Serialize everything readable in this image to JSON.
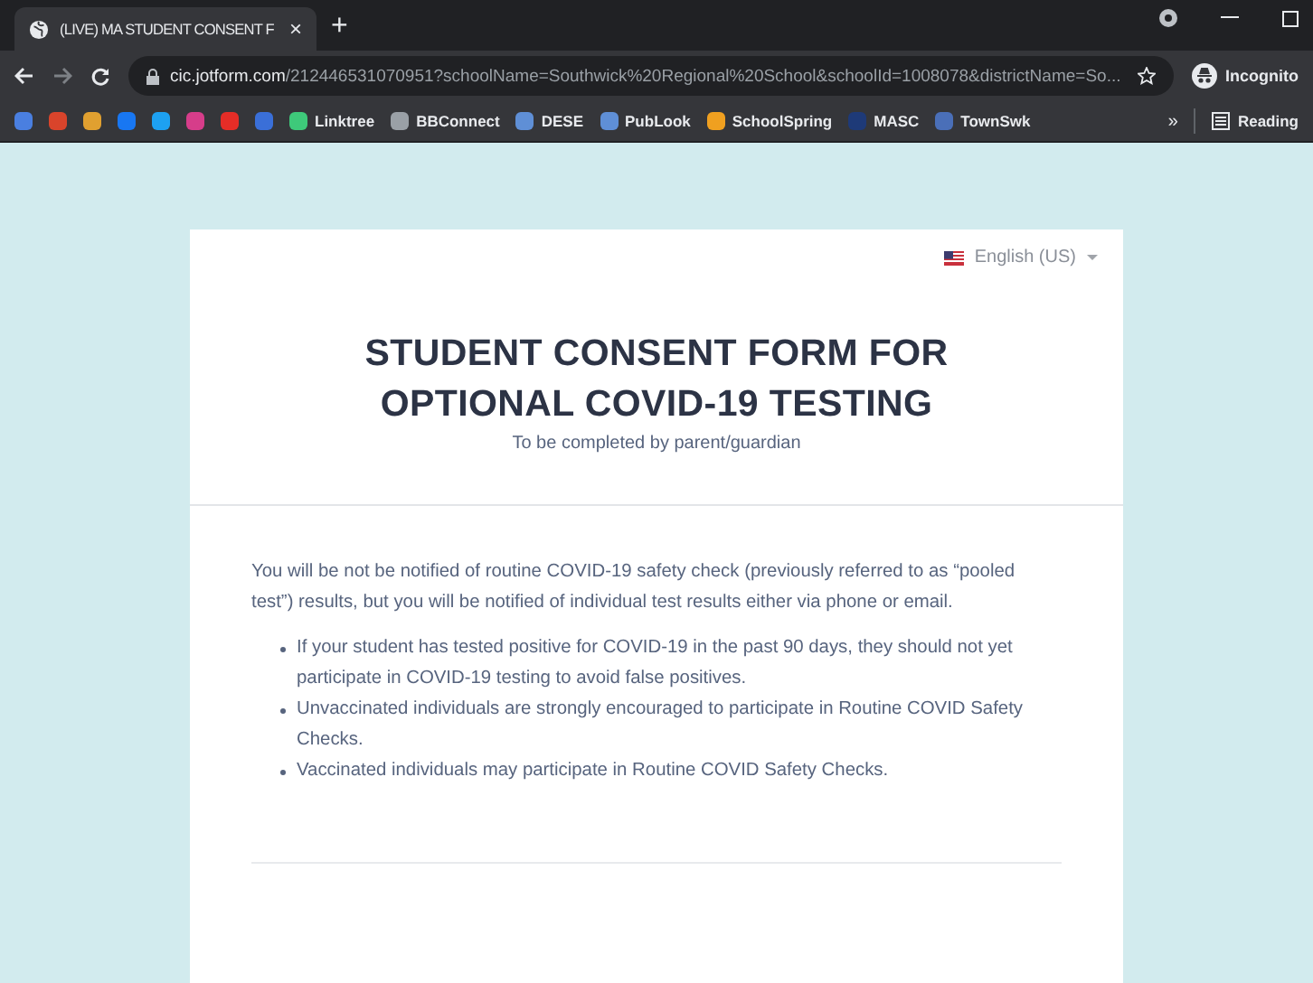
{
  "browser": {
    "tab": {
      "title": "(LIVE) MA STUDENT CONSENT F",
      "close": "×",
      "selected": true
    },
    "new_tab": "+",
    "address": {
      "domain": "cic.jotform.com",
      "path": "/212446531070951?schoolName=Southwick%20Regional%20School&schoolId=1008078&districtName=So..."
    },
    "profile": "Incognito",
    "bookmarks": [
      {
        "kind": "icon",
        "color": "#4a7fe0"
      },
      {
        "kind": "icon",
        "color": "#d9442b"
      },
      {
        "kind": "icon",
        "color": "#e0a030"
      },
      {
        "kind": "icon",
        "color": "#1877f2"
      },
      {
        "kind": "icon",
        "color": "#1da1f2"
      },
      {
        "kind": "icon",
        "color": "#d63d8a"
      },
      {
        "kind": "icon",
        "color": "#e52d27"
      },
      {
        "kind": "icon",
        "color": "#3a6fd8"
      },
      {
        "kind": "link",
        "label": "Linktree",
        "color": "#3ec97a"
      },
      {
        "kind": "link",
        "label": "BBConnect",
        "color": "#9aa0a6"
      },
      {
        "kind": "link",
        "label": "DESE",
        "color": "#5f8fd6"
      },
      {
        "kind": "link",
        "label": "PubLook",
        "color": "#5f8fd6"
      },
      {
        "kind": "link",
        "label": "SchoolSpring",
        "color": "#f0a020"
      },
      {
        "kind": "link",
        "label": "MASC",
        "color": "#1e3a78"
      },
      {
        "kind": "link",
        "label": "TownSwk",
        "color": "#4a6fb8"
      }
    ],
    "overflow": "»",
    "reading_list": "Reading"
  },
  "form": {
    "language": "English (US)",
    "title_lines": [
      "STUDENT CONSENT FORM FOR",
      "OPTIONAL COVID-19 TESTING"
    ],
    "subtitle": "To be completed by parent/guardian",
    "intro": "You will be not be notified of routine COVID-19 safety check (previously referred to as “pooled test”) results, but you will be notified of individual test results either via phone or email.",
    "bullets": [
      "If your student has tested positive for COVID-19 in the past 90 days, they should not yet participate in COVID-19 testing to avoid false positives.",
      "Unvaccinated individuals are strongly encouraged to participate in Routine COVID Safety Checks.",
      "Vaccinated individuals may participate in Routine COVID Safety Checks."
    ]
  }
}
